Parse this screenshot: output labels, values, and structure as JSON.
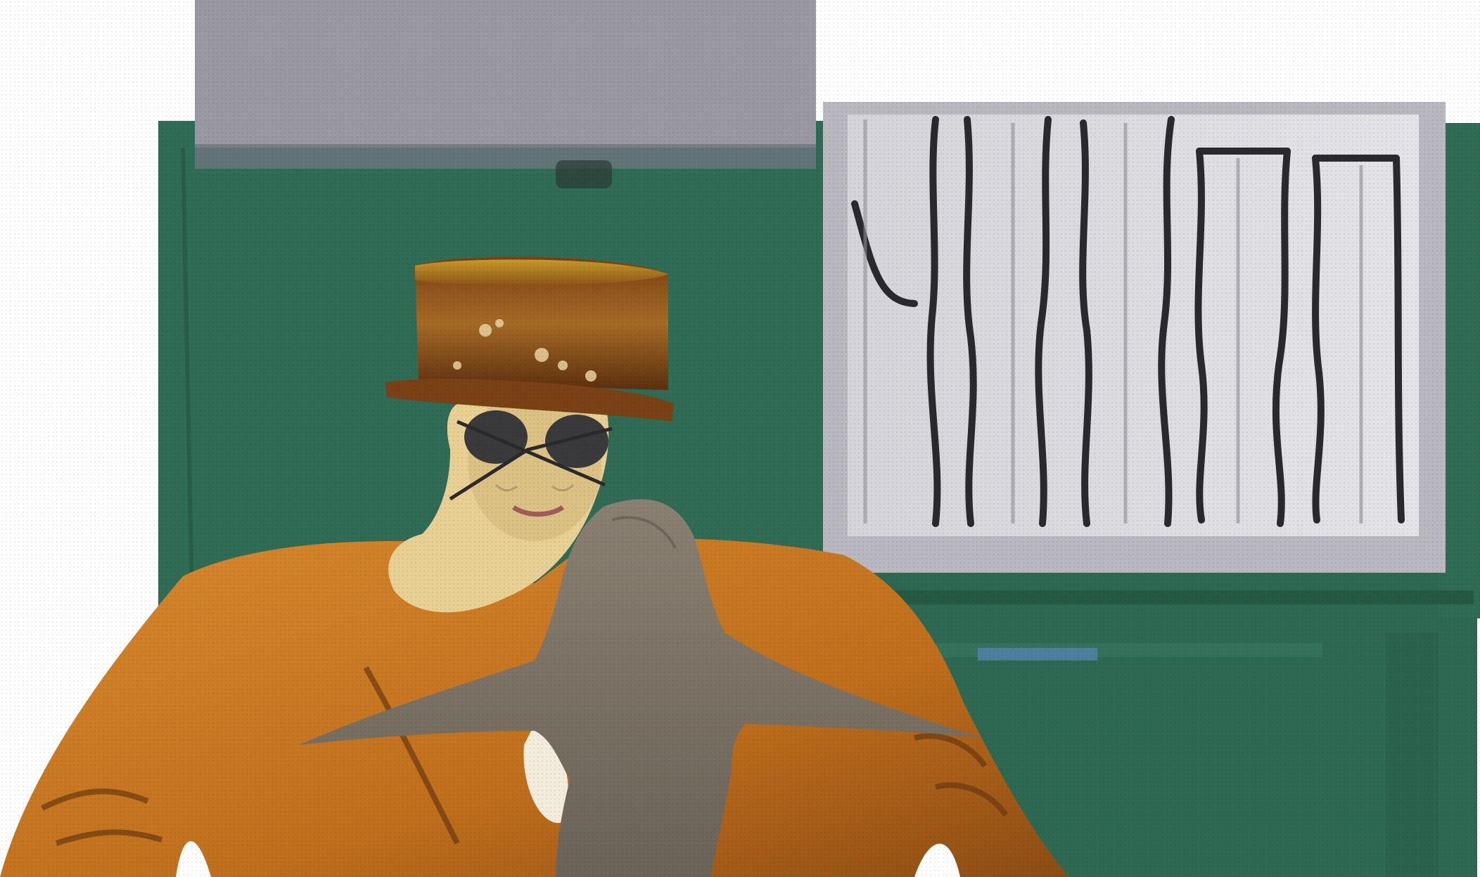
{
  "scene": {
    "description_free": true,
    "colors": {
      "background": "#ffffff",
      "wall_green": "#2f6b55",
      "wall_green_dark": "#24553f",
      "grey_panel": "#9a99a3",
      "photo_frame": "#b9b8c0",
      "photo_inner": "#d9d9de",
      "photo_lines": "#2a2a2e",
      "jacket_orange": "#c8761e",
      "jacket_dark": "#8a4a14",
      "skin": "#e8cf93",
      "hat_brown": "#6b3a12",
      "hat_gold": "#b7841f",
      "glasses": "#3a3a3d",
      "creature_grey": "#7d7467"
    }
  }
}
